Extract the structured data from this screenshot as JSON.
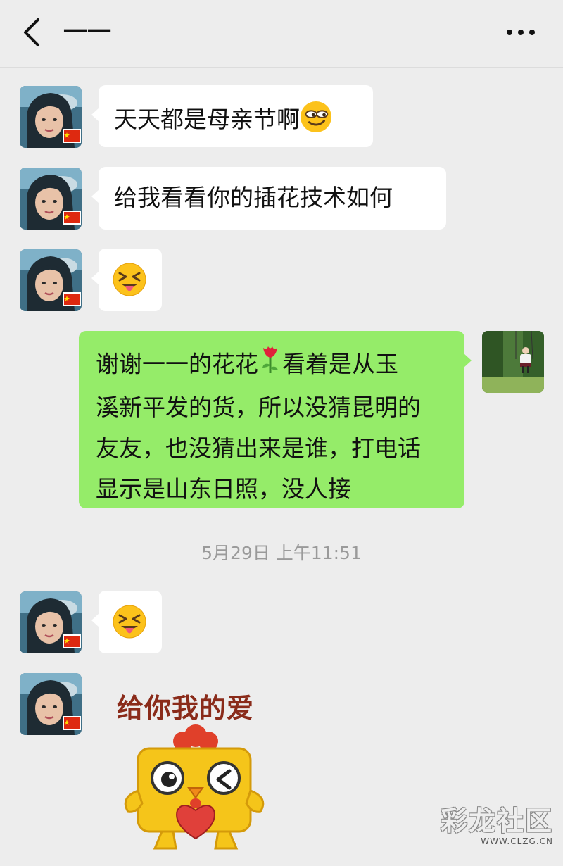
{
  "header": {
    "title": "一一",
    "back_icon": "chevron-left-icon",
    "more_icon": "more-horizontal-icon"
  },
  "messages": [
    {
      "side": "left",
      "text": "天天都是母亲节啊",
      "emoji": "grinning-smirk-emoji"
    },
    {
      "side": "left",
      "text": "给我看看你的插花技术如何"
    },
    {
      "side": "left",
      "emoji": "squinting-tongue-emoji"
    },
    {
      "side": "right",
      "lines": [
        "谢谢一一的花花",
        "看着是从玉",
        "溪新平发的货，所以没猜昆明的",
        "友友，也没猜出来是谁，打电话",
        "显示是山东日照，没人接"
      ],
      "inline_emoji": "rose-emoji"
    },
    {
      "side": "left",
      "emoji": "squinting-tongue-emoji"
    },
    {
      "side": "left",
      "sticker_text": "给你我的爱",
      "sticker": "chick-winking-heart-sticker"
    }
  ],
  "timestamp": "5月29日 上午11:51",
  "watermark": {
    "logo": "彩龙社区",
    "url": "WWW.CLZG.CN"
  },
  "colors": {
    "background": "#ededed",
    "bubble_left": "#ffffff",
    "bubble_right": "#95ec69",
    "timestamp": "#9a9a9a"
  }
}
